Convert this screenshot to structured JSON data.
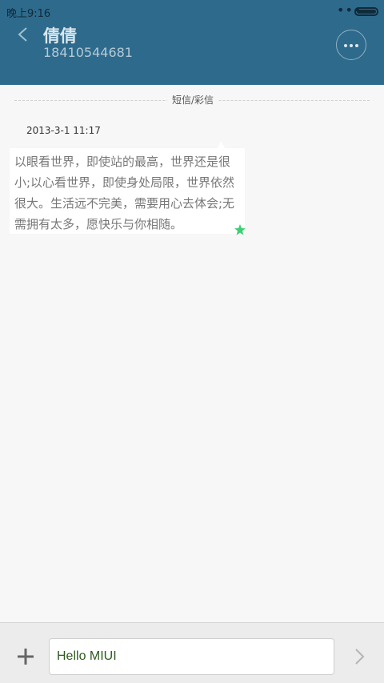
{
  "status_bar": {
    "time": "晚上9:16",
    "signal_dots": "•••"
  },
  "header": {
    "contact_name": "倩倩",
    "contact_number": "18410544681"
  },
  "thread": {
    "divider_label": "短信/彩信",
    "messages": [
      {
        "timestamp": "2013-3-1 11:17",
        "text": "以眼看世界，即使站的最高，世界还是很小;以心看世界，即使身处局限，世界依然很大。生活远不完美，需要用心去体会;无需拥有太多，愿快乐与你相随。",
        "starred": true
      }
    ]
  },
  "composer": {
    "input_value": "Hello MIUI"
  },
  "icons": {
    "back": "chevron-left-icon",
    "more": "more-dots-icon",
    "star": "star-icon",
    "attach": "plus-icon",
    "send": "chevron-right-icon"
  },
  "colors": {
    "header_bg": "#2e6a8c",
    "star": "#3ecf72",
    "input_text": "#2d5a1e"
  }
}
